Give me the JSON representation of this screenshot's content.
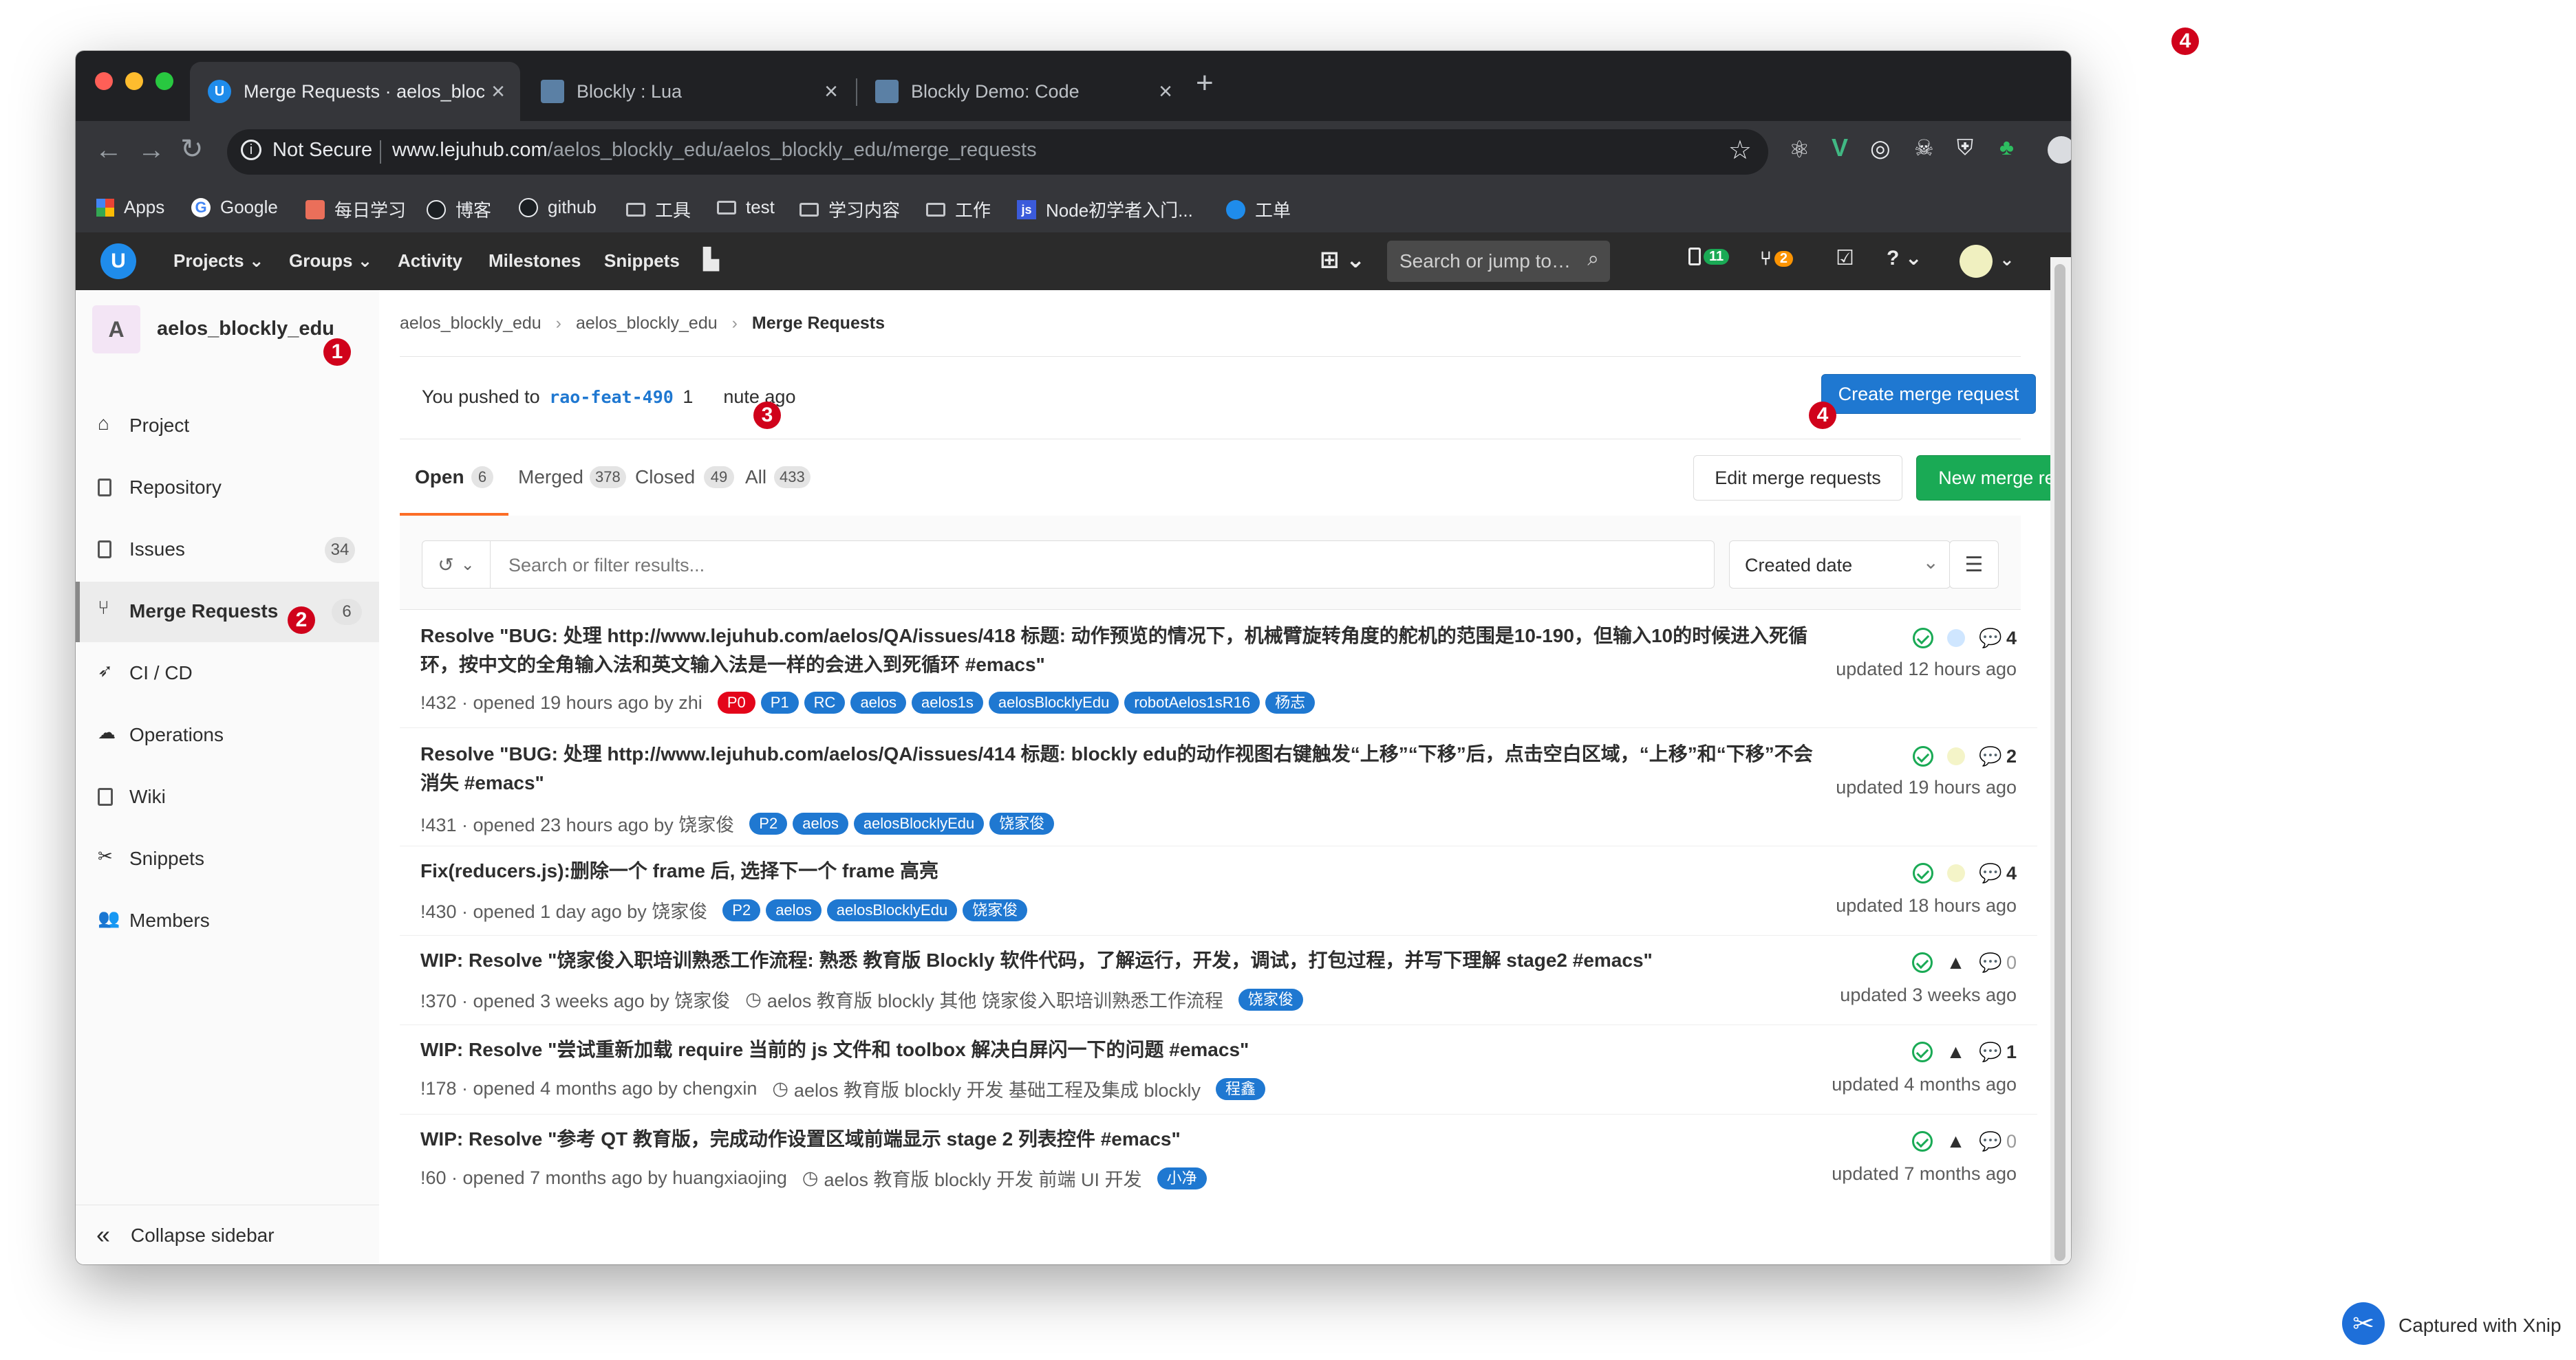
{
  "browser": {
    "tabs": [
      {
        "title": "Merge Requests · aelos_blockly_edu",
        "active": true
      },
      {
        "title": "Blockly : Lua",
        "active": false
      },
      {
        "title": "Blockly Demo: Code",
        "active": false
      }
    ],
    "new_tab_label": "+",
    "security_label": "Not Secure",
    "url_host": "www.lejuhub.com",
    "url_path": "/aelos_blockly_edu/aelos_blockly_edu/merge_requests",
    "bookmarks": [
      "Apps",
      "Google",
      "每日学习",
      "博客",
      "github",
      "工具",
      "test",
      "学习内容",
      "工作",
      "Node初学者入门...",
      "工单"
    ]
  },
  "gitlab_nav": {
    "projects": "Projects",
    "groups": "Groups",
    "activity": "Activity",
    "milestones": "Milestones",
    "snippets": "Snippets",
    "search_placeholder": "Search or jump to…",
    "issues_count": "11",
    "mr_count": "2"
  },
  "sidebar": {
    "avatar_letter": "A",
    "project_name": "aelos_blockly_edu",
    "items": [
      {
        "label": "Project",
        "icon": "home-icon"
      },
      {
        "label": "Repository",
        "icon": "doc-icon"
      },
      {
        "label": "Issues",
        "icon": "issues-icon",
        "count": "34"
      },
      {
        "label": "Merge Requests",
        "icon": "merge-request-icon",
        "count": "6",
        "active": true
      },
      {
        "label": "CI / CD",
        "icon": "rocket-icon"
      },
      {
        "label": "Operations",
        "icon": "cloud-gear-icon"
      },
      {
        "label": "Wiki",
        "icon": "book-icon"
      },
      {
        "label": "Snippets",
        "icon": "scissors-icon"
      },
      {
        "label": "Members",
        "icon": "users-icon"
      }
    ],
    "collapse_label": "Collapse sidebar"
  },
  "breadcrumb": [
    "aelos_blockly_edu",
    "aelos_blockly_edu",
    "Merge Requests"
  ],
  "push_alert": {
    "prefix": "You pushed to",
    "branch": "rao-feat-490",
    "suffix_start": "1",
    "suffix_end": "nute ago",
    "button": "Create merge request"
  },
  "mr_tabs": [
    {
      "label": "Open",
      "count": "6",
      "active": true
    },
    {
      "label": "Merged",
      "count": "378"
    },
    {
      "label": "Closed",
      "count": "49"
    },
    {
      "label": "All",
      "count": "433"
    }
  ],
  "actions": {
    "edit": "Edit merge requests",
    "new": "New merge request"
  },
  "filter": {
    "placeholder": "Search or filter results...",
    "sort": "Created date"
  },
  "merge_requests": [
    {
      "title": "Resolve \"BUG: 处理 http://www.lejuhub.com/aelos/QA/issues/418 标题: 动作预览的情况下，机械臂旋转角度的舵机的范围是10-190，但输入10的时候进入死循环，按中文的全角输入法和英文输入法是一样的会进入到死循环 #emacs\"",
      "meta": "!432 · opened 19 hours ago by zhi",
      "labels": [
        {
          "text": "P0",
          "color": "#e4051a"
        },
        {
          "text": "P1",
          "color": "#1f78d1"
        },
        {
          "text": "RC",
          "color": "#1f78d1"
        },
        {
          "text": "aelos",
          "color": "#1f78d1"
        },
        {
          "text": "aelos1s",
          "color": "#1f78d1"
        },
        {
          "text": "aelosBlocklyEdu",
          "color": "#1f78d1"
        },
        {
          "text": "robotAelos1sR16",
          "color": "#1f78d1"
        },
        {
          "text": "杨志",
          "color": "#1f78d1"
        }
      ],
      "comments": "4",
      "updated": "updated 12 hours ago"
    },
    {
      "title": "Resolve \"BUG: 处理 http://www.lejuhub.com/aelos/QA/issues/414 标题: blockly edu的动作视图右键触发“上移”“下移”后，点击空白区域，“上移”和“下移”不会消失 #emacs\"",
      "meta": "!431 · opened 23 hours ago by 饶家俊",
      "labels": [
        {
          "text": "P2",
          "color": "#1f78d1"
        },
        {
          "text": "aelos",
          "color": "#1f78d1"
        },
        {
          "text": "aelosBlocklyEdu",
          "color": "#1f78d1"
        },
        {
          "text": "饶家俊",
          "color": "#1f78d1"
        }
      ],
      "comments": "2",
      "updated": "updated 19 hours ago"
    },
    {
      "title": "Fix(reducers.js):删除一个 frame 后, 选择下一个 frame 高亮",
      "meta": "!430 · opened 1 day ago by 饶家俊",
      "labels": [
        {
          "text": "P2",
          "color": "#1f78d1"
        },
        {
          "text": "aelos",
          "color": "#1f78d1"
        },
        {
          "text": "aelosBlocklyEdu",
          "color": "#1f78d1"
        },
        {
          "text": "饶家俊",
          "color": "#1f78d1"
        }
      ],
      "comments": "4",
      "updated": "updated 18 hours ago"
    },
    {
      "title": "WIP: Resolve \"饶家俊入职培训熟悉工作流程: 熟悉 教育版 Blockly 软件代码，了解运行，开发，调试，打包过程，并写下理解 stage2 #emacs\"",
      "meta": "!370 · opened 3 weeks ago by 饶家俊",
      "milestone": "aelos 教育版 blockly 其他 饶家俊入职培训熟悉工作流程",
      "labels": [
        {
          "text": "饶家俊",
          "color": "#1f78d1"
        }
      ],
      "comments": "0",
      "updated": "updated 3 weeks ago"
    },
    {
      "title": "WIP: Resolve \"尝试重新加载 require 当前的 js 文件和 toolbox 解决白屏闪一下的问题 #emacs\"",
      "meta": "!178 · opened 4 months ago by chengxin",
      "milestone": "aelos 教育版 blockly 开发 基础工程及集成 blockly",
      "labels": [
        {
          "text": "程鑫",
          "color": "#1f78d1"
        }
      ],
      "comments": "1",
      "updated": "updated 4 months ago"
    },
    {
      "title": "WIP: Resolve \"参考 QT 教育版，完成动作设置区域前端显示 stage 2 列表控件 #emacs\"",
      "meta": "!60 · opened 7 months ago by huangxiaojing",
      "milestone": "aelos 教育版 blockly 开发 前端 UI 开发",
      "labels": [
        {
          "text": "小净",
          "color": "#1f78d1"
        }
      ],
      "comments": "0",
      "updated": "updated 7 months ago"
    }
  ],
  "markers": [
    "1",
    "2",
    "3",
    "4",
    "4"
  ],
  "capture_label": "Captured with Xnip",
  "colors": {
    "accent_blue": "#1f78d1",
    "green": "#1aaa55",
    "red_marker": "#d0021b",
    "nav_dark": "#2b2b2b"
  }
}
